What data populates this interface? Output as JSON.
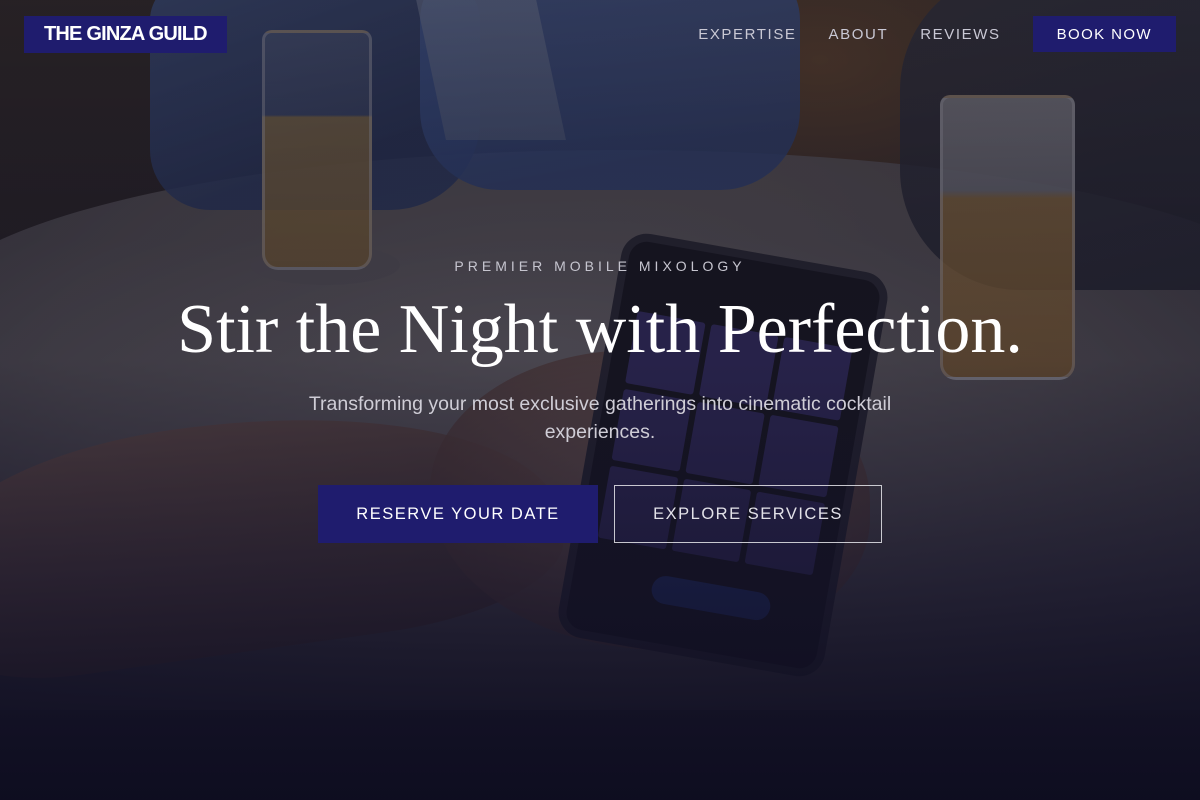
{
  "header": {
    "logo": "THE GINZA GUILD",
    "nav": [
      {
        "label": "EXPERTISE"
      },
      {
        "label": "ABOUT"
      },
      {
        "label": "REVIEWS"
      }
    ],
    "book_label": "BOOK NOW"
  },
  "hero": {
    "eyebrow": "PREMIER MOBILE MIXOLOGY",
    "headline": "Stir the Night with Perfection.",
    "subhead": "Transforming your most exclusive gatherings into cinematic cocktail experiences.",
    "primary_cta": "RESERVE YOUR DATE",
    "secondary_cta": "EXPLORE SERVICES"
  },
  "colors": {
    "accent": "#1f1c6e",
    "text": "#ffffff",
    "muted_text": "#c9c8d4",
    "overlay": "#141423"
  }
}
